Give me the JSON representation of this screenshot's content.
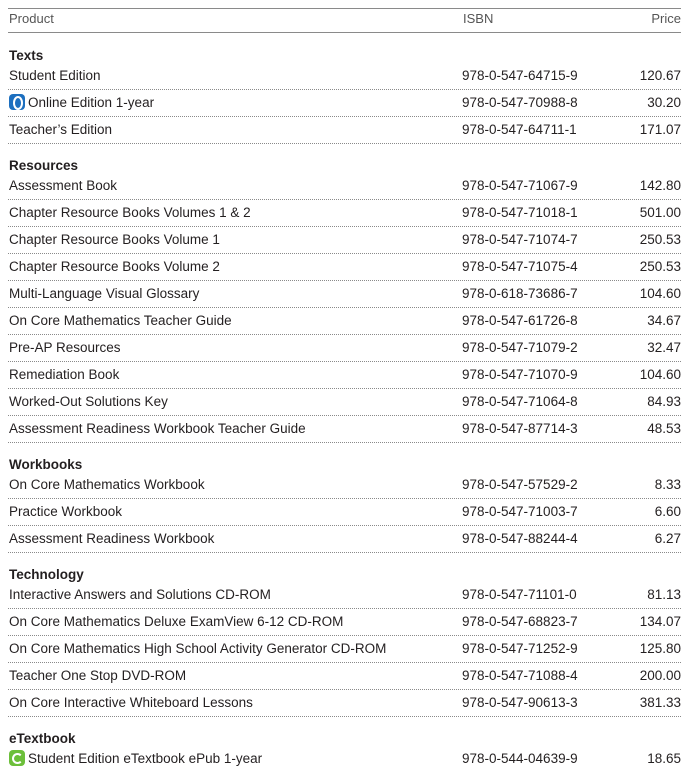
{
  "header": {
    "product": "Product",
    "isbn": "ISBN",
    "price": "Price"
  },
  "sections": [
    {
      "title": "Texts",
      "rows": [
        {
          "name": "Student Edition",
          "isbn": "978-0-547-64715-9",
          "price": "120.67"
        },
        {
          "name": "Online Edition 1-year",
          "isbn": "978-0-547-70988-8",
          "price": "30.20",
          "icon": "online-edition-icon"
        },
        {
          "name": "Teacher’s Edition",
          "isbn": "978-0-547-64711-1",
          "price": "171.07"
        }
      ]
    },
    {
      "title": "Resources",
      "rows": [
        {
          "name": "Assessment Book",
          "isbn": "978-0-547-71067-9",
          "price": "142.80"
        },
        {
          "name": "Chapter Resource Books Volumes 1 & 2",
          "isbn": "978-0-547-71018-1",
          "price": "501.00"
        },
        {
          "name": "Chapter Resource Books Volume 1",
          "isbn": "978-0-547-71074-7",
          "price": "250.53"
        },
        {
          "name": "Chapter Resource Books Volume  2",
          "isbn": "978-0-547-71075-4",
          "price": "250.53"
        },
        {
          "name": "Multi-Language Visual Glossary",
          "isbn": "978-0-618-73686-7",
          "price": "104.60"
        },
        {
          "name": "On Core Mathematics Teacher Guide",
          "isbn": "978-0-547-61726-8",
          "price": "34.67"
        },
        {
          "name": "Pre-AP Resources",
          "isbn": "978-0-547-71079-2",
          "price": "32.47"
        },
        {
          "name": "Remediation Book",
          "isbn": "978-0-547-71070-9",
          "price": "104.60"
        },
        {
          "name": "Worked-Out Solutions Key",
          "isbn": "978-0-547-71064-8",
          "price": "84.93"
        },
        {
          "name": "Assessment Readiness Workbook Teacher Guide",
          "isbn": "978-0-547-87714-3",
          "price": "48.53"
        }
      ]
    },
    {
      "title": "Workbooks",
      "rows": [
        {
          "name": "On Core Mathematics Workbook",
          "isbn": "978-0-547-57529-2",
          "price": "8.33"
        },
        {
          "name": "Practice Workbook",
          "isbn": "978-0-547-71003-7",
          "price": "6.60"
        },
        {
          "name": "Assessment Readiness Workbook",
          "isbn": "978-0-547-88244-4",
          "price": "6.27"
        }
      ]
    },
    {
      "title": "Technology",
      "rows": [
        {
          "name": "Interactive Answers and Solutions CD-ROM",
          "isbn": "978-0-547-71101-0",
          "price": "81.13"
        },
        {
          "name": "On Core Mathematics Deluxe ExamView 6-12 CD-ROM",
          "isbn": "978-0-547-68823-7",
          "price": "134.07"
        },
        {
          "name": "On Core Mathematics High School Activity Generator CD-ROM",
          "isbn": "978-0-547-71252-9",
          "price": "125.80"
        },
        {
          "name": "Teacher One Stop DVD-ROM",
          "isbn": "978-0-547-71088-4",
          "price": "200.00"
        },
        {
          "name": "On Core Interactive Whiteboard Lessons",
          "isbn": "978-0-547-90613-3",
          "price": "381.33"
        }
      ]
    },
    {
      "title": "eTextbook",
      "rows": [
        {
          "name": "Student Edition eTextbook ePub 1-year",
          "isbn": "978-0-544-04639-9",
          "price": "18.65",
          "icon": "etextbook-icon"
        }
      ]
    }
  ]
}
